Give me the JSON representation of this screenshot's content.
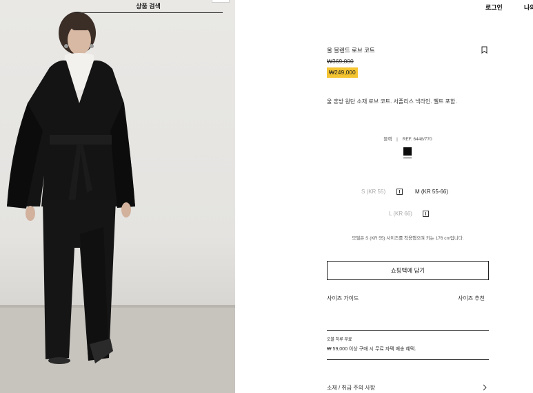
{
  "search": {
    "label": "상품 검색"
  },
  "header": {
    "login": "로그인",
    "my": "나의"
  },
  "product": {
    "title": "울 블렌드 로브 코트",
    "old_price": "₩369,000",
    "new_price": "₩249,000",
    "description": "울 혼방 원단 소재 로브 코트. 서플리스 넥라인. 벨트 포함.",
    "color_name": "블랙",
    "ref": "REF. 6448/770",
    "swatch_color": "#0b0b0b",
    "accent_color": "#f4c431"
  },
  "sizes": [
    {
      "label": "S (KR 55)",
      "available": false
    },
    {
      "label": "M (KR 55-66)",
      "available": true
    },
    {
      "label": "L (KR 66)",
      "available": false
    }
  ],
  "model_note": "모델은 S (KR 55) 사이즈를 착용했으며 키는 176 cm입니다.",
  "actions": {
    "add_to_bag": "쇼핑백에 담기",
    "size_guide": "사이즈 가이드",
    "size_recommend": "사이즈 추천"
  },
  "shipping": {
    "title": "오블 하루 무료",
    "text": "₩ 59,000 이상 구매 시 무료 자택 배송 혜택."
  },
  "care": {
    "label": "소재 / 취급 주의 사항"
  },
  "icons": {
    "bookmark": "bookmark-icon",
    "info": "size-info-icon",
    "chevron": "chevron-right-icon"
  }
}
